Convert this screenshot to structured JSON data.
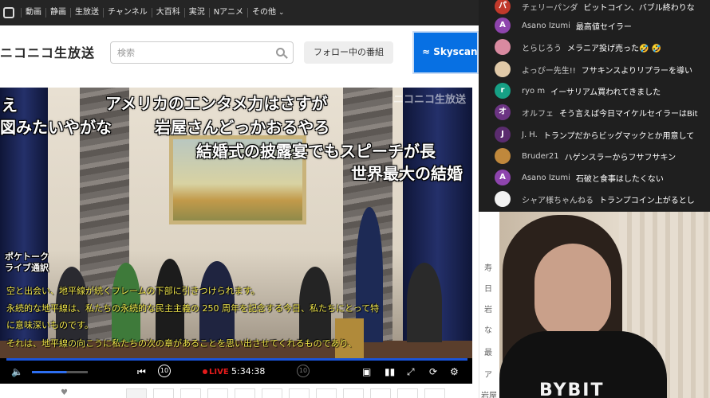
{
  "top_nav": {
    "items": [
      "動画",
      "静画",
      "生放送",
      "チャンネル",
      "大百科",
      "実況",
      "Nアニメ"
    ],
    "more_label": "その他"
  },
  "header": {
    "logo": "ニコニコ生放送",
    "search_placeholder": "検索",
    "follow_button": "フォロー中の番組",
    "banner_text": "Skyscanner"
  },
  "video": {
    "watermark": "ニコニコ生放送",
    "comments": [
      {
        "text": "え"
      },
      {
        "text": "アメリカのエンタメ力はさすが"
      },
      {
        "text": "図みたいやがな"
      },
      {
        "text": "岩屋さんどっかおるやろ"
      },
      {
        "text": "結婚式の披露宴でもスピーチが長"
      },
      {
        "text": "世界最大の結婚"
      }
    ],
    "caption_logo": [
      "ポケトーク",
      "ライブ通訳"
    ],
    "subtitles": [
      "空と出会い、地平線が続くフレームの下部に引きつけられます。",
      "永続的な地平線は、私たちの永続的な民主主義の 250 周年を記念する今日、私たちにとって特",
      "に意味深いものです。",
      "それは、地平線の向こうに私たちの次の章があることを思い出させてくれるものであり、"
    ],
    "controls": {
      "live_label": "LIVE",
      "elapsed": "5:34:38",
      "volume_fraction": 0.62
    }
  },
  "chat": {
    "messages": [
      {
        "avatar_letter": "パ",
        "avatar_color": "#c0392b",
        "user": "チェリーパンダ",
        "text": "ビットコイン、バブル終わりな"
      },
      {
        "avatar_letter": "A",
        "avatar_color": "#8e44ad",
        "user": "Asano Izumi",
        "text": "最高値セイラー"
      },
      {
        "avatar_letter": "",
        "avatar_color": "#d98aa0",
        "user": "とらじろう",
        "text": "メラニア投げ売った🤣 🤣"
      },
      {
        "avatar_letter": "",
        "avatar_color": "#e0c9a8",
        "user": "よっぴー先生!!",
        "text": "フサキンスよりリプラーを導い"
      },
      {
        "avatar_letter": "r",
        "avatar_color": "#16a085",
        "user": "ryo m",
        "text": "イーサリアム買われてきました"
      },
      {
        "avatar_letter": "オ",
        "avatar_color": "#6c3483",
        "user": "オルフェ",
        "text": "そう言えば今日マイケルセイラーはBit"
      },
      {
        "avatar_letter": "J",
        "avatar_color": "#5b2c6f",
        "user": "J. H.",
        "text": "トランプだからビッグマックとか用意して"
      },
      {
        "avatar_letter": "",
        "avatar_color": "#c0883c",
        "user": "Bruder21",
        "text": "ハゲンスラーからフサフサキン"
      },
      {
        "avatar_letter": "A",
        "avatar_color": "#8e44ad",
        "user": "Asano Izumi",
        "text": "石破と食事はしたくない"
      },
      {
        "avatar_letter": "",
        "avatar_color": "#f2f2f2",
        "user": "シャア様ちゃんねる",
        "text": "トランプコイン上がるとし"
      }
    ]
  },
  "right_strip": [
    "寿",
    "日",
    "岩",
    "な",
    "最",
    "ア",
    "岩屋"
  ],
  "webcam": {
    "shirt_logo": "BYBIT"
  }
}
